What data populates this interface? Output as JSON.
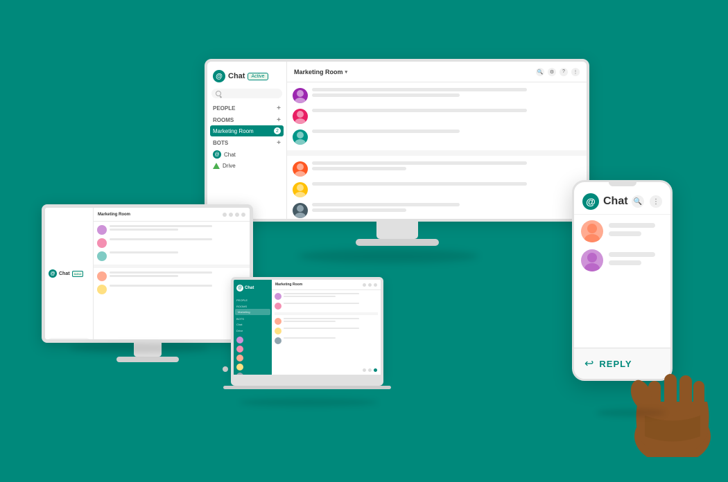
{
  "app": {
    "name": "Chat",
    "logo_char": "@",
    "active_badge": "Active"
  },
  "sidebar": {
    "search_placeholder": "Search",
    "sections": [
      {
        "label": "PEOPLE",
        "items": []
      },
      {
        "label": "ROOMS",
        "items": [
          {
            "name": "Marketing Room",
            "badge": "2",
            "active": true
          }
        ]
      },
      {
        "label": "BOTS",
        "items": [
          {
            "name": "Chat",
            "icon": "chat-bot-icon"
          },
          {
            "name": "Drive",
            "icon": "drive-icon"
          }
        ]
      }
    ]
  },
  "chat": {
    "room_title": "Marketing Room",
    "header_icons": [
      "search-icon",
      "settings-icon",
      "help-icon",
      "apps-icon"
    ]
  },
  "phone": {
    "app_name": "Chat",
    "header_icons": [
      "search-icon",
      "more-icon"
    ],
    "reply_label": "REPLY"
  },
  "colors": {
    "brand": "#00897B",
    "bg": "#00897B",
    "surface": "#ffffff",
    "sidebar_active": "#00897B",
    "text_primary": "#333333",
    "text_secondary": "#666666",
    "divider": "#e8e8e8"
  },
  "avatars": [
    {
      "color": "#9C27B0",
      "label": "user-1"
    },
    {
      "color": "#E91E63",
      "label": "user-2"
    },
    {
      "color": "#009688",
      "label": "user-3"
    },
    {
      "color": "#FF5722",
      "label": "user-4"
    },
    {
      "color": "#FFC107",
      "label": "user-5"
    },
    {
      "color": "#455A64",
      "label": "user-6"
    }
  ]
}
